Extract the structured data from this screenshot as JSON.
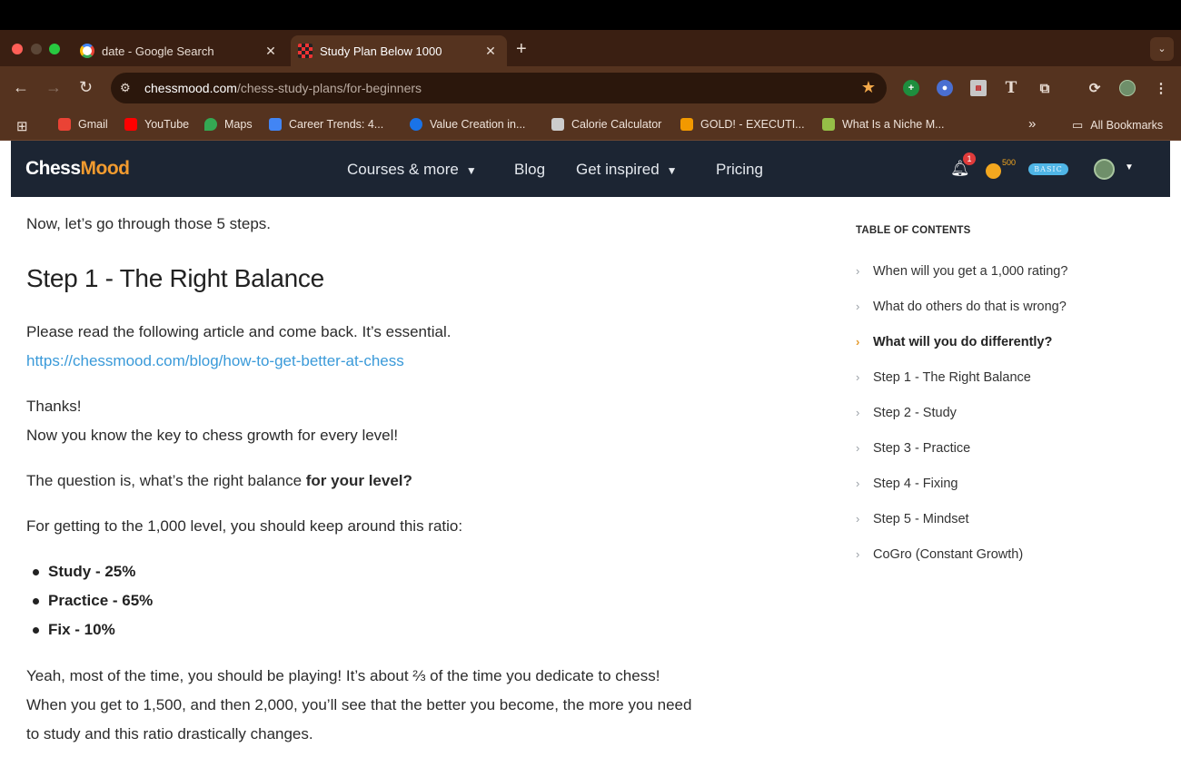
{
  "browser": {
    "tabs": [
      {
        "title": "date - Google Search",
        "icon": "google-icon"
      },
      {
        "title": "Study Plan Below 1000",
        "icon": "chessboard-icon",
        "active": true
      }
    ],
    "url_host": "chessmood.com",
    "url_path": "/chess-study-plans/for-beginners",
    "bookmarks": [
      {
        "label": "Gmail",
        "color": "#ea4335"
      },
      {
        "label": "YouTube",
        "color": "#ff0000"
      },
      {
        "label": "Maps",
        "color": "#34a853"
      },
      {
        "label": "Career Trends: 4...",
        "color": "#4285f4"
      },
      {
        "label": "Value Creation in...",
        "color": "#1a73e8"
      },
      {
        "label": "Calorie Calculator",
        "color": "#cccccc"
      },
      {
        "label": "GOLD! - EXECUTI...",
        "color": "#f29900"
      },
      {
        "label": "What Is a Niche M...",
        "color": "#95bf47"
      }
    ],
    "overflow": "»",
    "all_bookmarks": "All Bookmarks"
  },
  "site": {
    "logo_main": "Chess",
    "logo_accent": "Mood",
    "nav": {
      "courses": "Courses & more",
      "blog": "Blog",
      "inspired": "Get inspired",
      "pricing": "Pricing"
    },
    "notifications": "1",
    "coins": "500",
    "plan": "BASIC"
  },
  "article": {
    "intro": "Now, let’s go through those 5 steps.",
    "heading": "Step 1 - The Right Balance",
    "p1": "Please read the following article and come back. It’s essential.",
    "link": "https://chessmood.com/blog/how-to-get-better-at-chess",
    "thanks": "Thanks!",
    "p2": "Now you know the key to chess growth for every level!",
    "p3_start": "The question is, what’s the right balance ",
    "p3_bold": "for your level?",
    "p4": "For getting to the 1,000 level, you should keep around this ratio:",
    "bullets": [
      "Study - 25%",
      "Practice - 65%",
      "Fix - 10%"
    ],
    "p5_line1": "Yeah, most of the time, you should be playing! It’s about ⅔ of the time you dedicate to chess!",
    "p5_line2": "When you get to 1,500, and then 2,000, you’ll see that the better you become, the more you need",
    "p5_line3": "to study and this ratio drastically changes."
  },
  "toc": {
    "heading": "TABLE OF CONTENTS",
    "items": [
      "When will you get a 1,000 rating?",
      "What do others do that is wrong?",
      "What will you do differently?",
      "Step 1 - The Right Balance",
      "Step 2 - Study",
      "Step 3 - Practice",
      "Step 4 - Fixing",
      "Step 5 - Mindset",
      "CoGro (Constant Growth)"
    ],
    "active_index": 2
  }
}
